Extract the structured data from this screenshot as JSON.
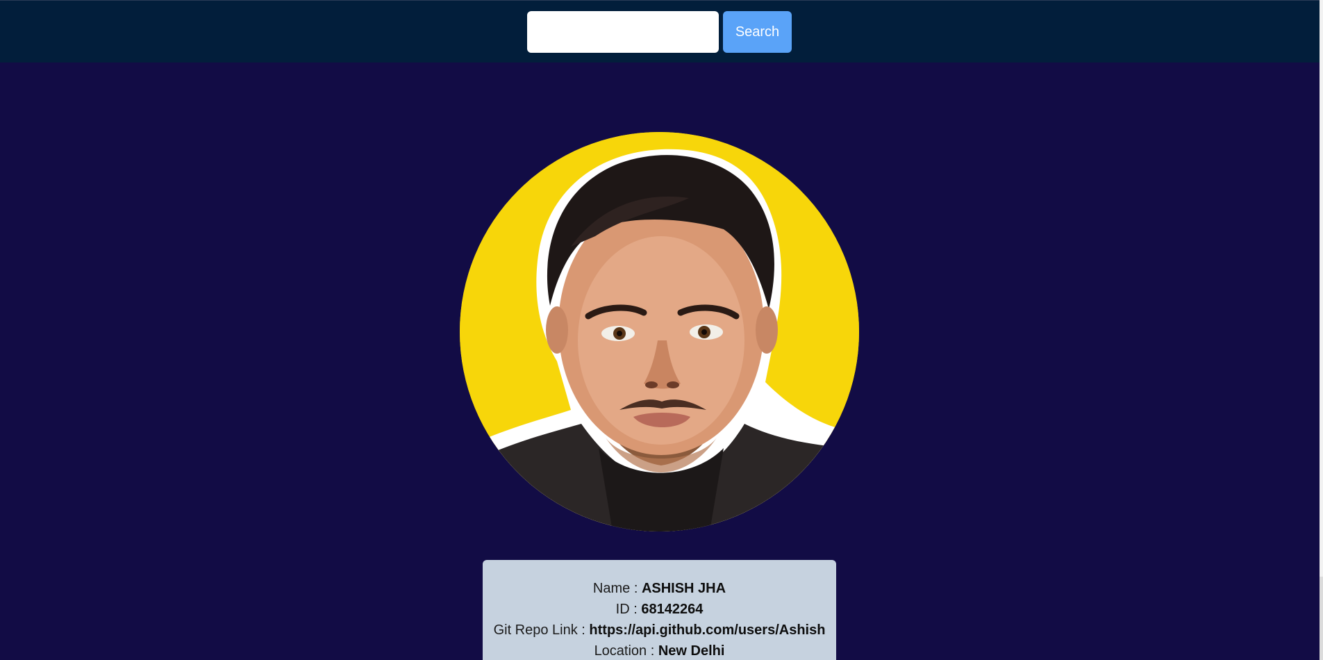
{
  "search": {
    "input_value": "",
    "placeholder": "",
    "button_label": "Search"
  },
  "colors": {
    "page_background": "#120c45",
    "topbar_background": "#021e3b",
    "button_background": "#5aa3f8",
    "card_background": "#c6d2df",
    "avatar_background": "#f7d60a"
  },
  "profile": {
    "avatar_icon": "user-avatar-illustration",
    "fields": [
      {
        "label": "Name : ",
        "value": "ASHISH JHA"
      },
      {
        "label": "ID : ",
        "value": "68142264"
      },
      {
        "label": "Git Repo Link : ",
        "value": "https://api.github.com/users/Ashish"
      },
      {
        "label": "Location : ",
        "value": "New Delhi"
      }
    ]
  }
}
